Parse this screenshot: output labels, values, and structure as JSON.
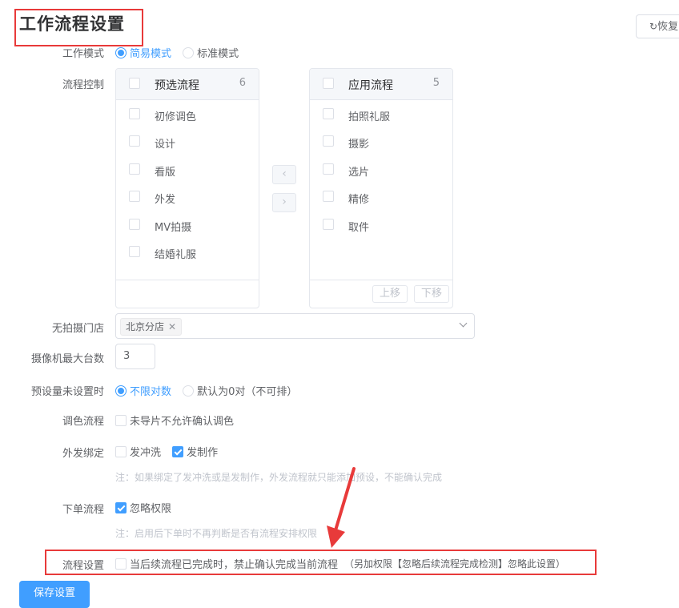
{
  "page": {
    "title": "工作流程设置",
    "restore_label": "恢复"
  },
  "work_mode": {
    "label": "工作模式",
    "options": [
      "简易模式",
      "标准模式"
    ],
    "selected": "简易模式"
  },
  "flow_control": {
    "label": "流程控制",
    "left": {
      "title": "预选流程",
      "count": "6",
      "items": [
        "初修调色",
        "设计",
        "看版",
        "外发",
        "MV拍摄",
        "结婚礼服"
      ]
    },
    "right": {
      "title": "应用流程",
      "count": "5",
      "items": [
        "拍照礼服",
        "摄影",
        "选片",
        "精修",
        "取件"
      ],
      "move_up": "上移",
      "move_down": "下移"
    }
  },
  "no_shoot_store": {
    "label": "无拍摄门店",
    "tags": [
      "北京分店"
    ]
  },
  "camera_max": {
    "label": "摄像机最大台数",
    "value": "3"
  },
  "preset_unset": {
    "label": "预设量未设置时",
    "options": [
      "不限对数",
      "默认为0对（不可排）"
    ],
    "selected": "不限对数"
  },
  "color_flow": {
    "label": "调色流程",
    "option": "未导片不允许确认调色",
    "checked": false
  },
  "outsource_bind": {
    "label": "外发绑定",
    "options": [
      {
        "text": "发冲洗",
        "checked": false
      },
      {
        "text": "发制作",
        "checked": true
      }
    ],
    "note": "注：如果绑定了发冲洗或是发制作，外发流程就只能添加预设，不能确认完成"
  },
  "order_flow": {
    "label": "下单流程",
    "option": "忽略权限",
    "checked": true,
    "note": "注：启用后下单时不再判断是否有流程安排权限"
  },
  "flow_setting": {
    "label": "流程设置",
    "option": "当后续流程已完成时，禁止确认完成当前流程",
    "hint": "（另加权限【忽略后续流程完成检测】忽略此设置）",
    "checked": false
  },
  "save_label": "保存设置",
  "colors": {
    "primary": "#409eff",
    "annotation_red": "#e83a3a"
  }
}
